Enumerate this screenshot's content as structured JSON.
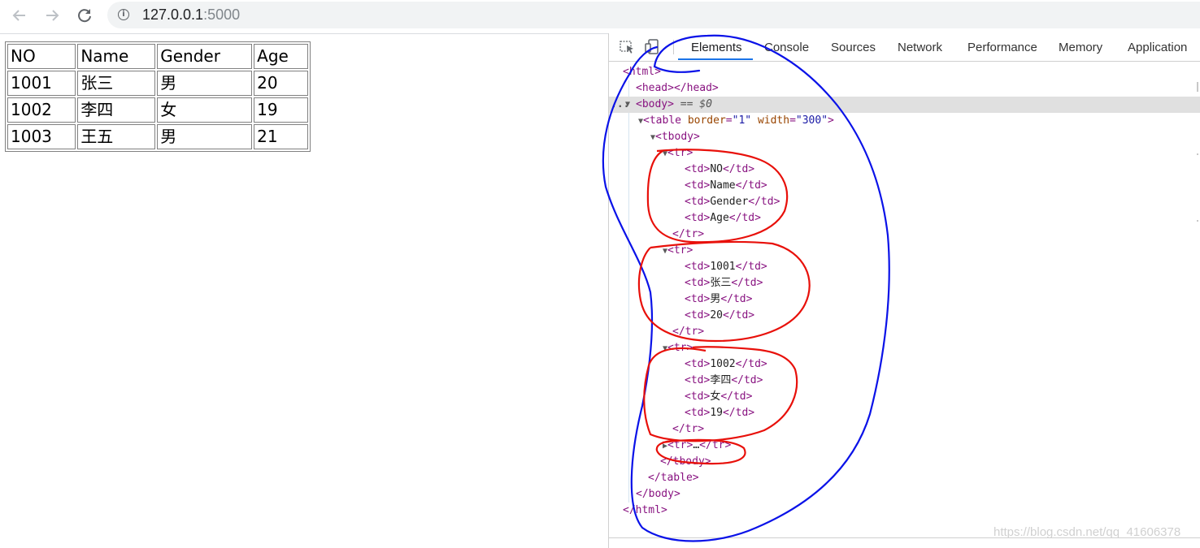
{
  "browser": {
    "url_host": "127.0.0.1",
    "url_port": ":5000"
  },
  "page_table": {
    "rows": [
      [
        "NO",
        "Name",
        "Gender",
        "Age"
      ],
      [
        "1001",
        "张三",
        "男",
        "20"
      ],
      [
        "1002",
        "李四",
        "女",
        "19"
      ],
      [
        "1003",
        "王五",
        "男",
        "21"
      ]
    ]
  },
  "devtools": {
    "tabs": [
      "Elements",
      "Console",
      "Sources",
      "Network",
      "Performance",
      "Memory",
      "Application"
    ],
    "active_tab": "Elements",
    "selected_marker": "== $0",
    "ellipsis": "...",
    "tree": {
      "html_open": "<html>",
      "head": "<head></head>",
      "body_open": "<body>",
      "table_tag": "table",
      "attr_border": "border",
      "val_border": "\"1\"",
      "attr_width": "width",
      "val_width": "\"300\"",
      "tbody_open": "<tbody>",
      "tr_open": "<tr>",
      "tr_close": "</tr>",
      "td_open": "<td>",
      "td_close": "</td>",
      "collapsed_ellipsis": "…",
      "tbody_close": "</tbody>",
      "table_close": "</table>",
      "body_close": "</body>",
      "html_close": "</html>",
      "row1_cells": [
        "NO",
        "Name",
        "Gender",
        "Age"
      ],
      "row2_cells": [
        "1001",
        "张三",
        "男",
        "20"
      ],
      "row3_cells": [
        "1002",
        "李四",
        "女",
        "19"
      ]
    }
  },
  "watermark": "https://blog.csdn.net/qq_41606378",
  "colors": {
    "annotation_blue": "#0a12e8",
    "annotation_red": "#e8100a",
    "tab_active_underline": "#1a73e8",
    "tag_color": "#881280",
    "attr_color": "#994500",
    "value_color": "#1a1aa6"
  },
  "icons": [
    "back-arrow-icon",
    "forward-arrow-icon",
    "reload-icon",
    "info-icon",
    "inspect-element-icon",
    "device-toolbar-icon"
  ]
}
